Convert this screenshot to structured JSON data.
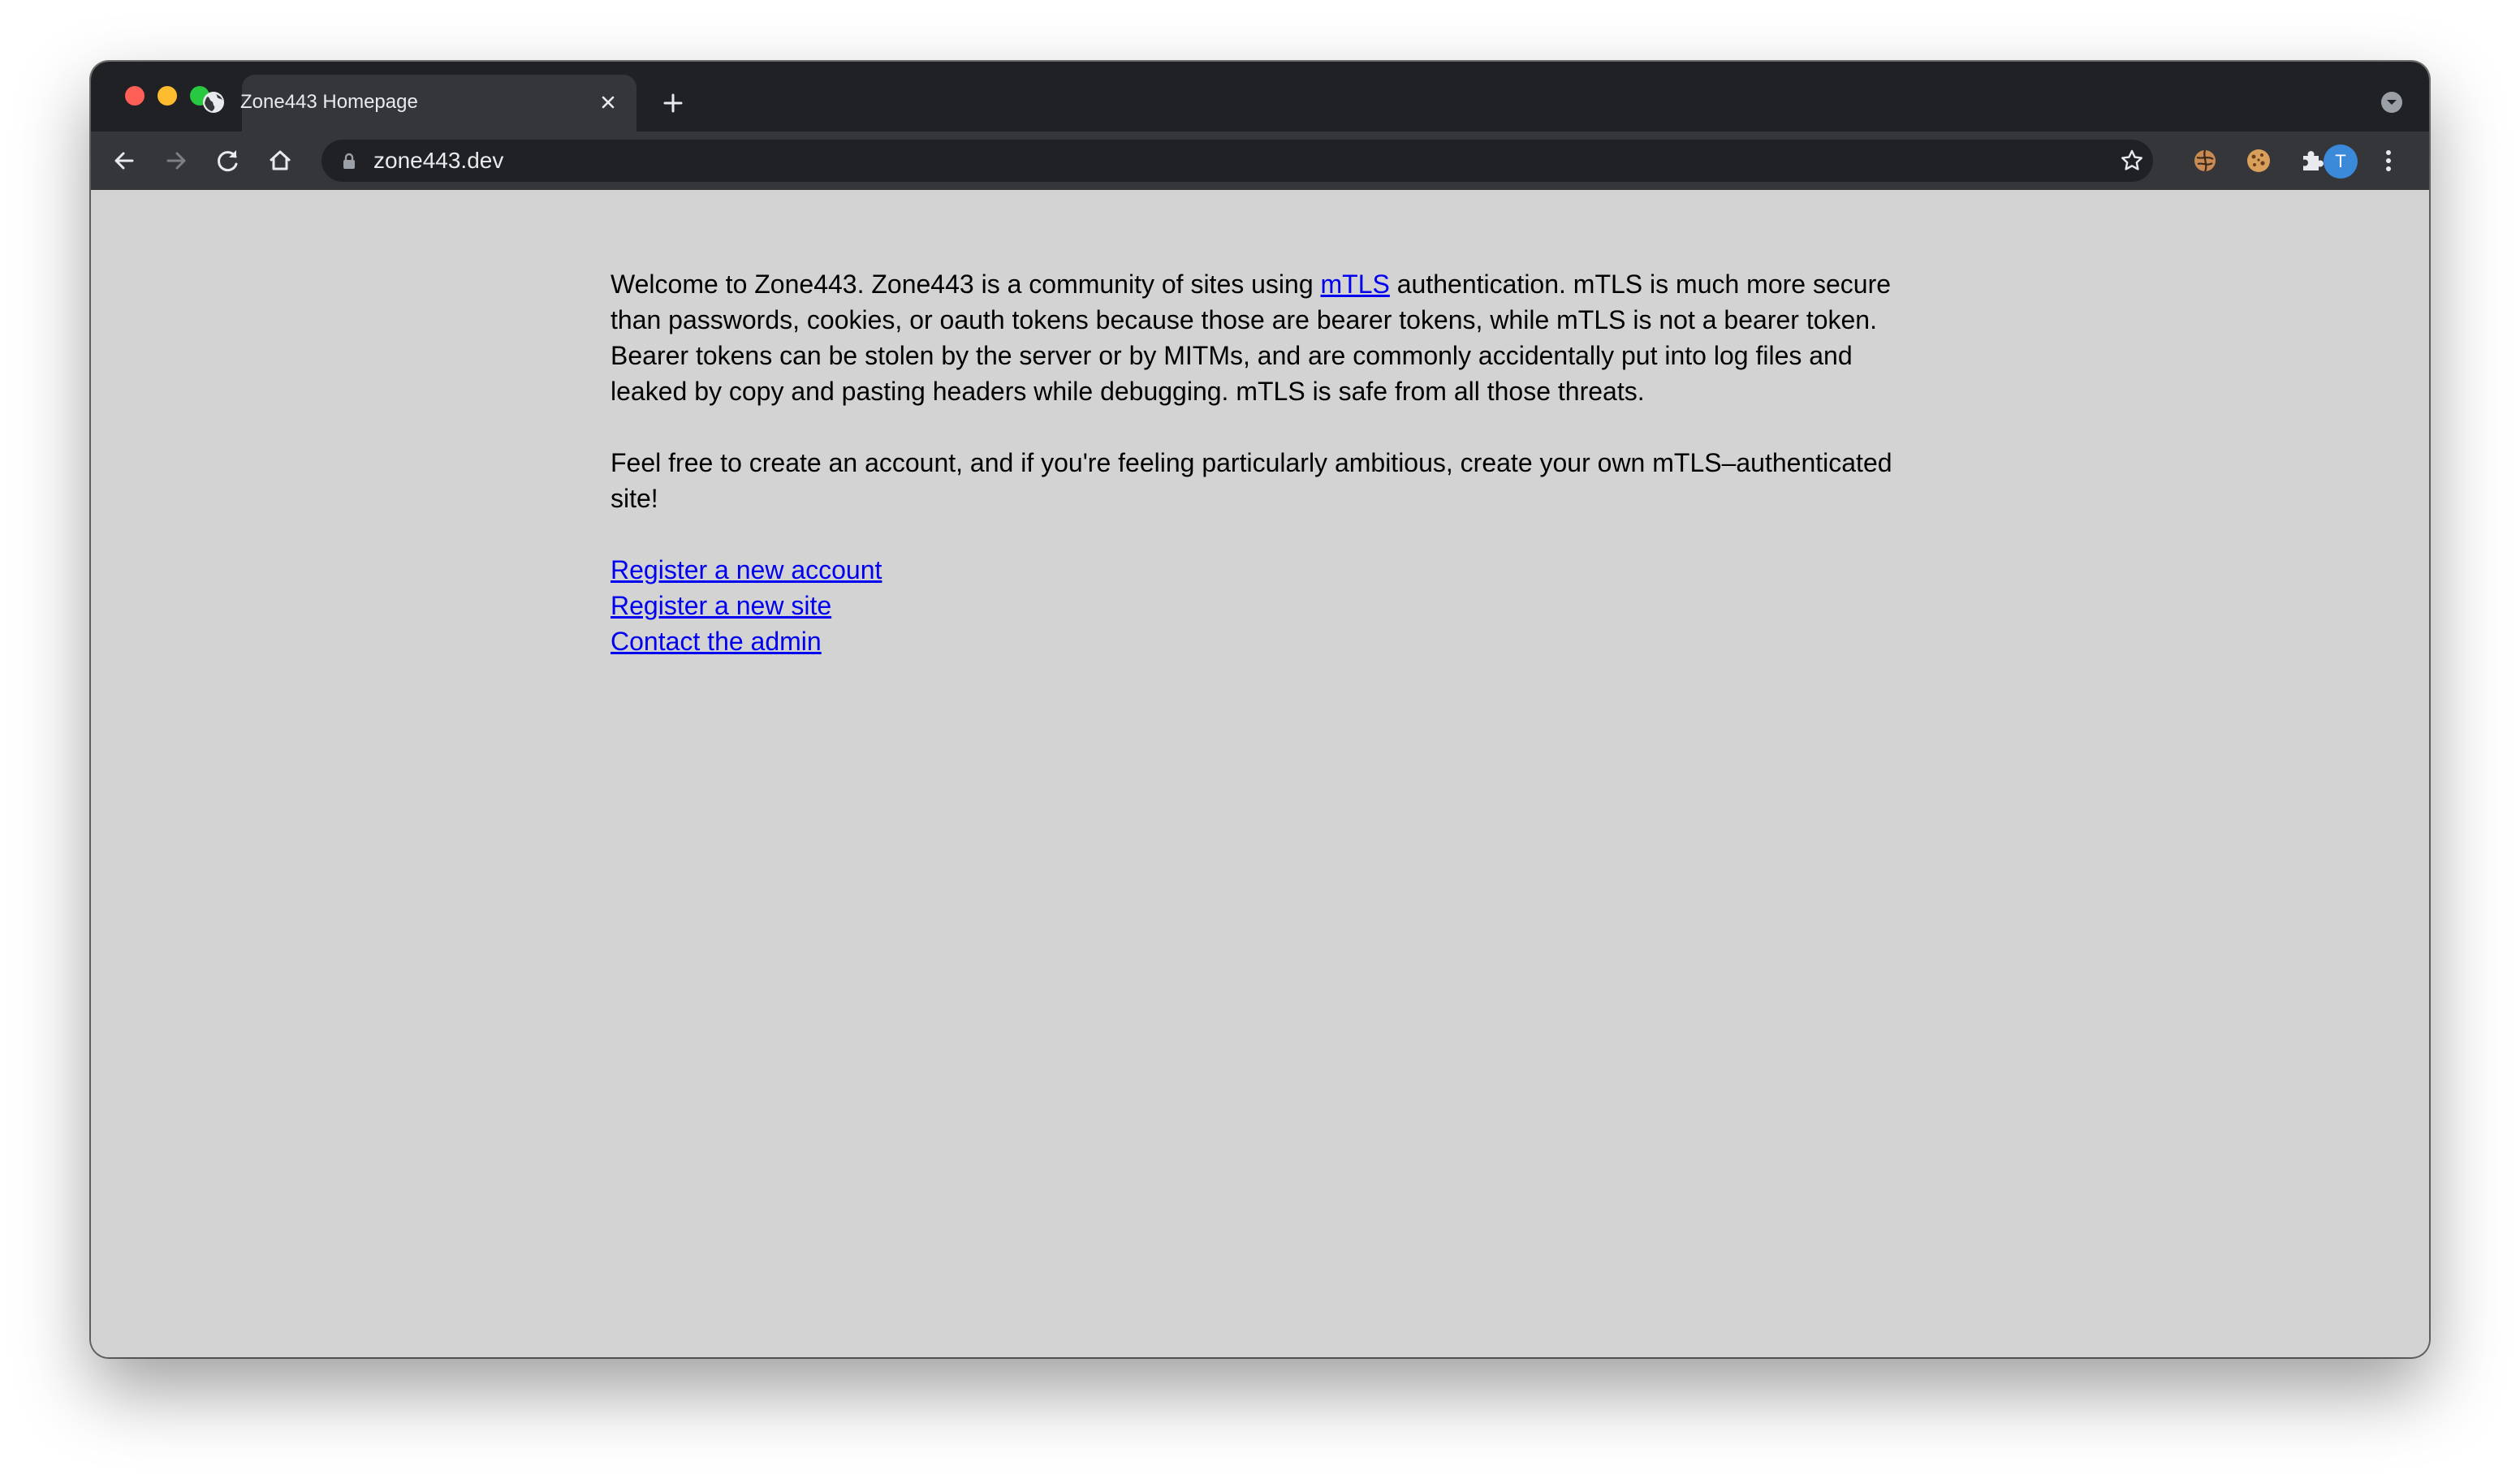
{
  "browser": {
    "tab": {
      "title": "Zone443 Homepage"
    },
    "address_bar": {
      "url": "zone443.dev"
    },
    "profile_initial": "T"
  },
  "page": {
    "intro": {
      "before_link": "Welcome to Zone443. Zone443 is a community of sites using ",
      "link_text": "mTLS",
      "after_link": " authentication. mTLS is much more secure than passwords, cookies, or oauth tokens because those are bearer tokens, while mTLS is not a bearer token. Bearer tokens can be stolen by the server or by MITMs, and are commonly accidentally put into log files and leaked by copy and pasting headers while debugging. mTLS is safe from all those threats."
    },
    "invite": "Feel free to create an account, and if you're feeling particularly ambitious, create your own mTLS–authenticated site!",
    "links": {
      "register_account": "Register a new account",
      "register_site": "Register a new site",
      "contact_admin": "Contact the admin"
    }
  },
  "colors": {
    "page_background": "#d3d3d3",
    "link": "#0000ee",
    "chrome_dark": "#202124",
    "chrome_toolbar": "#35363a"
  },
  "icons": [
    "globe-icon",
    "close-icon",
    "plus-icon",
    "back-arrow-icon",
    "forward-arrow-icon",
    "reload-icon",
    "home-icon",
    "lock-icon",
    "star-icon",
    "extension-icon",
    "cookie-icon",
    "puzzle-icon",
    "kebab-menu-icon",
    "tab-search-icon"
  ]
}
